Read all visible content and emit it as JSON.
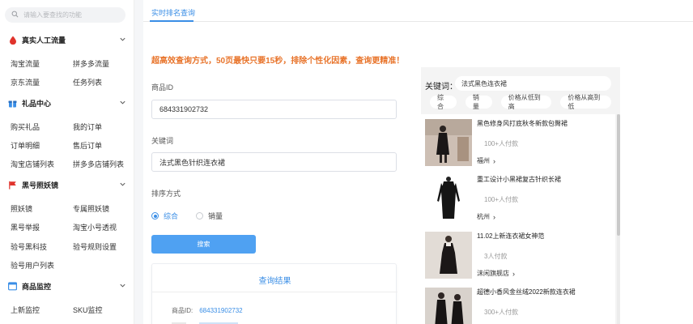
{
  "sidebar": {
    "search_placeholder": "请输入要查找的功能",
    "sections": [
      {
        "title": "真实人工流量",
        "items": [
          "淘宝流量",
          "拼多多流量",
          "京东流量",
          "任务列表"
        ]
      },
      {
        "title": "礼品中心",
        "items": [
          "购买礼品",
          "我的订单",
          "订单明细",
          "售后订单",
          "淘宝店铺列表",
          "拼多多店铺列表"
        ]
      },
      {
        "title": "黑号照妖镜",
        "items": [
          "照妖镜",
          "专属照妖镜",
          "黑号举报",
          "淘宝小号透视",
          "验号黑科技",
          "验号规则设置",
          "验号用户列表"
        ]
      },
      {
        "title": "商品监控",
        "items": [
          "上新监控",
          "SKU监控"
        ]
      }
    ]
  },
  "main": {
    "tab_label": "实时排名查询",
    "headline": "超高效查询方式，50页最快只要15秒，排除个性化因素，查询更精准！",
    "product_id_label": "商品ID",
    "product_id_value": "684331902732",
    "keyword_label": "关键词",
    "keyword_value": "法式黑色针织连衣裙",
    "sort_label": "排序方式",
    "sort_options": [
      "综合",
      "销量"
    ],
    "sort_selected": "综合",
    "search_button": "搜索",
    "result": {
      "title": "查询结果",
      "product_id_key": "商品ID:",
      "product_id_value": "684331902732"
    }
  },
  "preview": {
    "keyword_label": "关键词：",
    "keyword_value": "法式黑色连衣裙",
    "chips": [
      "综合",
      "销量",
      "价格从低到高",
      "价格从高到低"
    ],
    "products": [
      {
        "name": "黑色修身风打底秋冬新款包臀裙",
        "sold": "100+人付款",
        "location": "福州"
      },
      {
        "name": "重工设计小黑裙复古针织长裙",
        "sold": "100+人付款",
        "location": "杭州"
      },
      {
        "name": "11.02上新连衣裙女神范",
        "sold": "3人付款",
        "location": "沫闲旗舰店"
      },
      {
        "name": "超德小香风金丝绒2022新款连衣裙",
        "sold": "300+人付款",
        "location": ""
      }
    ]
  },
  "colors": {
    "accent": "#3a8ee6",
    "headline": "#e8742b",
    "button": "#4fa1f2"
  }
}
